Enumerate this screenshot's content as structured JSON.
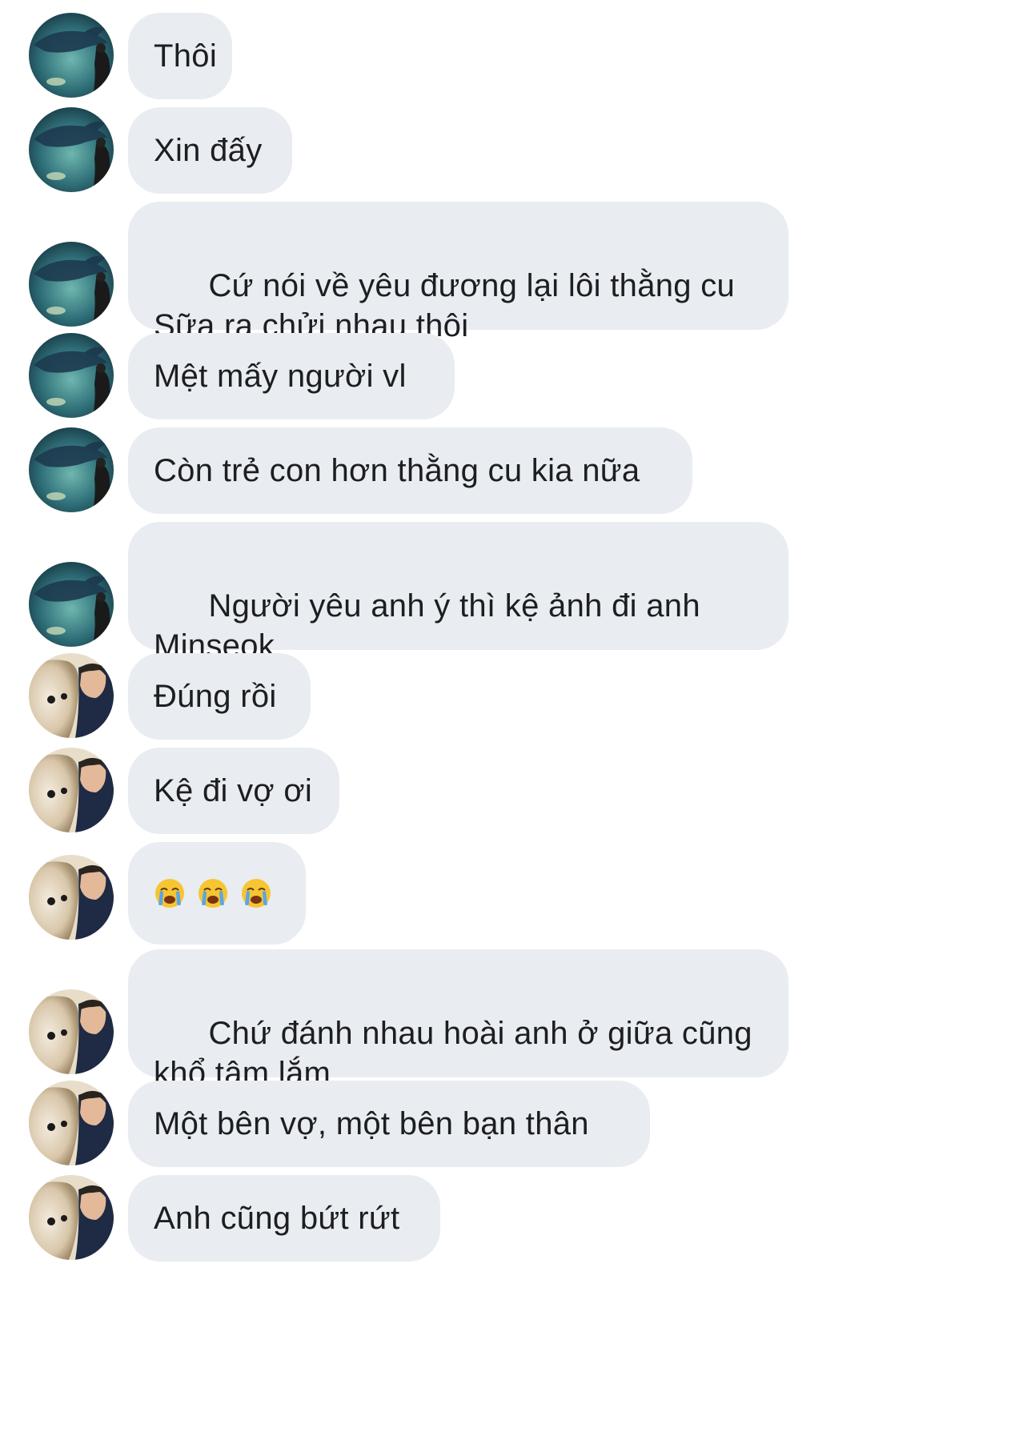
{
  "messages": [
    {
      "sender": "A",
      "text": "Thôi"
    },
    {
      "sender": "A",
      "text": "Xin đấy"
    },
    {
      "sender": "A",
      "text": "Cứ nói về yêu đương lại lôi thằng cu\nSữa ra chửi nhau thôi"
    },
    {
      "sender": "A",
      "text": "Mệt mấy người vl"
    },
    {
      "sender": "A",
      "text": "Còn trẻ con hơn thằng cu kia nữa"
    },
    {
      "sender": "A",
      "text": "Người yêu anh ý thì kệ ảnh đi anh\nMinseok"
    },
    {
      "sender": "B",
      "text": "Đúng rồi"
    },
    {
      "sender": "B",
      "text": "Kệ đi vợ ơi"
    },
    {
      "sender": "B",
      "emoji": [
        "loudly-crying-face",
        "loudly-crying-face",
        "loudly-crying-face"
      ]
    },
    {
      "sender": "B",
      "text": "Chứ đánh nhau hoài anh ở giữa cũng\nkhổ tâm lắm"
    },
    {
      "sender": "B",
      "text": "Một bên vợ, một bên bạn thân"
    },
    {
      "sender": "B",
      "text": "Anh cũng bứt rứt"
    }
  ],
  "colors": {
    "bubble": "#e9ecf0",
    "text": "#1c1e21",
    "emoji_face": "#f7c531",
    "emoji_tear": "#5ba5e6"
  }
}
